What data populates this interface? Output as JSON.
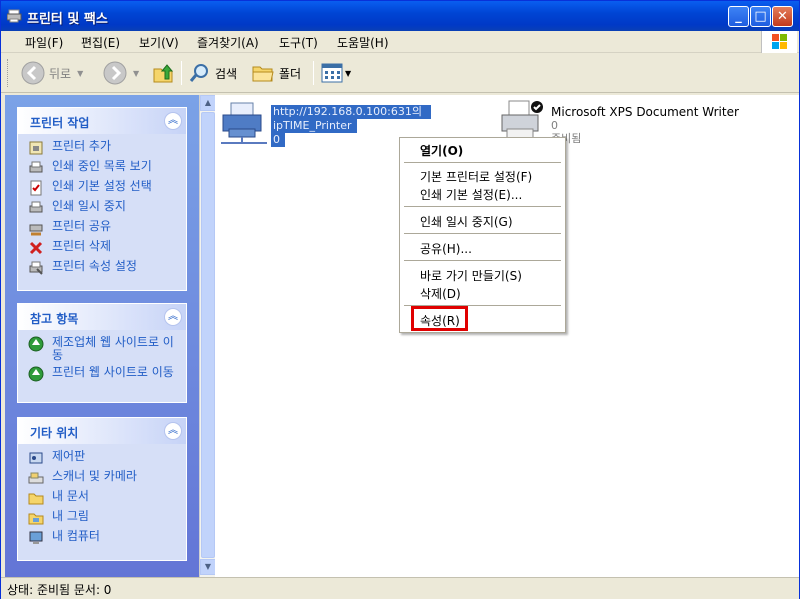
{
  "window": {
    "title": "프린터 및 팩스"
  },
  "menubar": {
    "items": [
      "파일(F)",
      "편집(E)",
      "보기(V)",
      "즐겨찾기(A)",
      "도구(T)",
      "도움말(H)"
    ]
  },
  "toolbar": {
    "back": "뒤로",
    "search": "검색",
    "folders": "폴더"
  },
  "left_pane": {
    "printer_tasks": {
      "title": "프린터 작업",
      "items": [
        "프린터 추가",
        "인쇄 중인 목록 보기",
        "인쇄 기본 설정 선택",
        "인쇄 일시 중지",
        "프린터 공유",
        "프린터 삭제",
        "프린터 속성 설정"
      ]
    },
    "see_also": {
      "title": "참고 항목",
      "items": [
        "제조업체 웹 사이트로 이동",
        "프린터 웹 사이트로 이동"
      ]
    },
    "other_places": {
      "title": "기타 위치",
      "items": [
        "제어판",
        "스캐너 및 카메라",
        "내 문서",
        "내 그림",
        "내 컴퓨터"
      ]
    }
  },
  "printers": [
    {
      "name_line1": "http://192.168.0.100:631의",
      "name_line2": "ipTIME_Printer",
      "docs": "0"
    },
    {
      "name": "Microsoft XPS Document Writer",
      "docs": "0",
      "status": "준비됨"
    }
  ],
  "context_menu": {
    "open": "열기(O)",
    "set_default": "기본 프린터로 설정(F)",
    "print_prefs": "인쇄 기본 설정(E)...",
    "pause": "인쇄 일시 중지(G)",
    "sharing": "공유(H)...",
    "create_shortcut": "바로 가기 만들기(S)",
    "delete": "삭제(D)",
    "properties": "속성(R)"
  },
  "statusbar": {
    "text": "상태: 준비됨 문서: 0"
  },
  "colors": {
    "highlight": "#e00000",
    "selection": "#316ac5",
    "task_link": "#215dc6"
  }
}
